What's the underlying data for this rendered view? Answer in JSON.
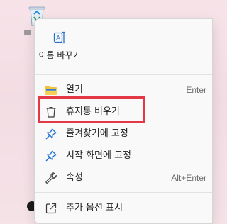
{
  "desktop": {
    "icon": "recycle-bin-icon"
  },
  "context_menu": {
    "quick_actions": [
      {
        "label": "이름 바꾸기",
        "icon": "rename-icon"
      }
    ],
    "items": [
      {
        "label": "열기",
        "shortcut": "Enter",
        "icon": "folder-icon"
      },
      {
        "label": "휴지통 비우기",
        "shortcut": "",
        "icon": "trash-icon",
        "highlighted": true
      },
      {
        "label": "즐겨찾기에 고정",
        "shortcut": "",
        "icon": "pin-icon"
      },
      {
        "label": "시작 화면에 고정",
        "shortcut": "",
        "icon": "pin-icon"
      },
      {
        "label": "속성",
        "shortcut": "Alt+Enter",
        "icon": "wrench-icon"
      },
      {
        "label": "추가 옵션 표시",
        "shortcut": "",
        "icon": "external-link-icon"
      }
    ]
  },
  "colors": {
    "highlight_border": "#e53846",
    "menu_bg": "#f9f9f9",
    "pin_blue": "#1d6fd0",
    "folder_yellow": "#f4c13f"
  }
}
